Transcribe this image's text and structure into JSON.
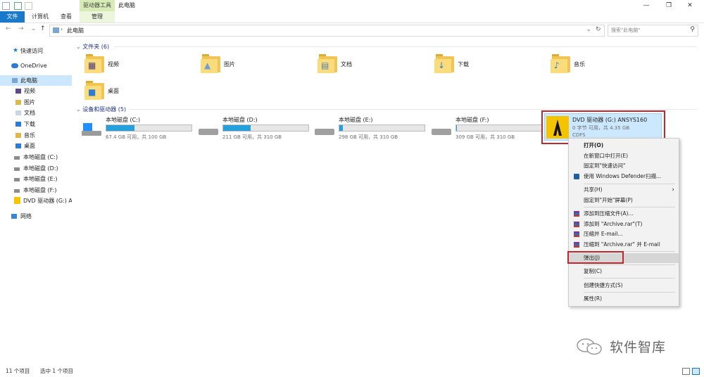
{
  "window": {
    "title": "此电脑",
    "context_tab_title": "驱动器工具",
    "min_btn": "—",
    "max_btn": "❐",
    "close_btn": "✕"
  },
  "ribbon": {
    "tabs": [
      "文件",
      "计算机",
      "查看",
      "管理"
    ]
  },
  "address": {
    "path": "此电脑",
    "search_placeholder": "搜索\"此电脑\"",
    "dropdown": "⌄",
    "refresh": "↻"
  },
  "nav": {
    "items": [
      "快速访问",
      "OneDrive",
      "此电脑",
      "视频",
      "图片",
      "文档",
      "下载",
      "音乐",
      "桌面",
      "本地磁盘 (C:)",
      "本地磁盘 (D:)",
      "本地磁盘 (E:)",
      "本地磁盘 (F:)",
      "DVD 驱动器 (G:) AN",
      "网络"
    ]
  },
  "folders_section": {
    "header": "文件夹 (6)",
    "items": [
      "视频",
      "图片",
      "文档",
      "下载",
      "音乐",
      "桌面"
    ]
  },
  "drives_section": {
    "header": "设备和驱动器 (5)",
    "drives": [
      {
        "name": "本地磁盘 (C:)",
        "free_text": "67.4 GB 可用，共 100 GB",
        "used_fraction": 0.33
      },
      {
        "name": "本地磁盘 (D:)",
        "free_text": "211 GB 可用，共 310 GB",
        "used_fraction": 0.32
      },
      {
        "name": "本地磁盘 (E:)",
        "free_text": "298 GB 可用，共 310 GB",
        "used_fraction": 0.04
      },
      {
        "name": "本地磁盘 (F:)",
        "free_text": "309 GB 可用，共 310 GB",
        "used_fraction": 0.01
      }
    ],
    "dvd": {
      "name": "DVD 驱动器 (G:) ANSYS160",
      "free_text": "0 字节 可用，共 4.35 GB",
      "fs": "CDFS"
    }
  },
  "context_menu": {
    "items": {
      "open": "打开(O)",
      "open_new_window": "在新窗口中打开(E)",
      "pin_quick": "固定到\"快速访问\"",
      "defender": "使用 Windows Defender扫描...",
      "share": "共享(H)",
      "pin_start": "固定到\"开始\"屏幕(P)",
      "add_archive": "添加到压缩文件(A)...",
      "add_rar": "添加到 \"Archive.rar\"(T)",
      "compress_email": "压缩并 E-mail...",
      "compress_rar_email": "压缩到 \"Archive.rar\" 并 E-mail",
      "eject": "弹出(J)",
      "copy": "复制(C)",
      "create_shortcut": "创建快捷方式(S)",
      "properties": "属性(R)"
    },
    "share_arrow": "›"
  },
  "status": {
    "count": "11 个项目",
    "selected": "选中 1 个项目"
  },
  "watermark": "软件智库",
  "colors": {
    "accent": "#1979ca",
    "highlight_border": "#c1272d",
    "selected_bg": "#cce8ff",
    "folder": "#f2c553"
  }
}
